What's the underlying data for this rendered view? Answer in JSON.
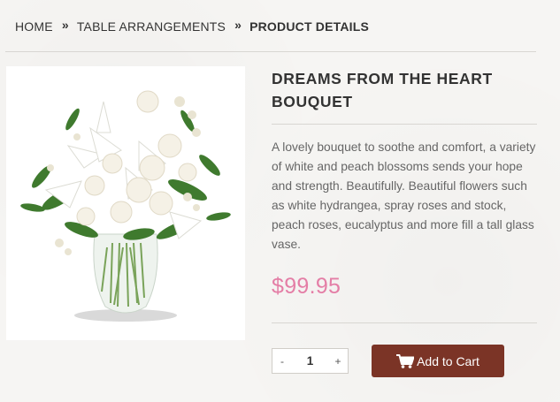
{
  "breadcrumb": {
    "items": [
      "HOME",
      "TABLE ARRANGEMENTS",
      "PRODUCT DETAILS"
    ],
    "separator": "»"
  },
  "product": {
    "title": "DREAMS FROM THE HEART BOUQUET",
    "description": "A lovely bouquet to soothe and comfort, a variety of white and peach blossoms sends your hope and strength. Beautifully. Beautiful flowers such as white hydrangea, spray roses and stock, peach roses, eucalyptus and more fill a tall glass vase.",
    "price": "$99.95",
    "image_icon": "flower-bouquet-image"
  },
  "quantity": {
    "decrement": "-",
    "value": "1",
    "increment": "+"
  },
  "cart": {
    "label": "Add to Cart",
    "icon": "shopping-cart-icon"
  },
  "colors": {
    "price": "#e47ea6",
    "button": "#7b3426"
  }
}
